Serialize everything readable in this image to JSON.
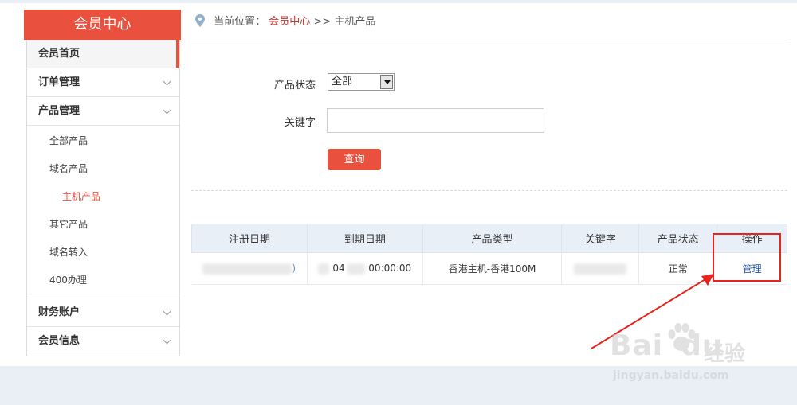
{
  "sidebar": {
    "title": "会员中心",
    "home": "会员首页",
    "groups": [
      {
        "label": "订单管理"
      },
      {
        "label": "产品管理"
      }
    ],
    "product_items": [
      "全部产品",
      "域名产品",
      "主机产品",
      "其它产品",
      "域名转入",
      "400办理"
    ],
    "bottom_groups": [
      {
        "label": "财务账户"
      },
      {
        "label": "会员信息"
      }
    ]
  },
  "breadcrumb": {
    "prefix": "当前位置：",
    "link": "会员中心",
    "sep": ">>",
    "current": "主机产品"
  },
  "filter": {
    "status_label": "产品状态",
    "status_value": "全部",
    "keyword_label": "关键字",
    "keyword_value": "",
    "query_button": "查询"
  },
  "table": {
    "headers": [
      "注册日期",
      "到期日期",
      "产品类型",
      "关键字",
      "产品状态",
      "操作"
    ],
    "rows": [
      {
        "reg_date_suffix": ")",
        "expire_prefix": "04",
        "expire_time": "00:00:00",
        "type": "香港主机-香港100M",
        "keyword": "",
        "status": "正常",
        "action": "管理"
      }
    ]
  },
  "watermark": {
    "main": "Bai",
    "main2": "du",
    "cn": "经验",
    "url": "jingyan.baidu.com"
  },
  "colors": {
    "accent": "#e9503d",
    "link": "#c3332a",
    "ok": "#3d9b3d",
    "manage": "#1d4f9c",
    "annotation": "#e8231b"
  }
}
